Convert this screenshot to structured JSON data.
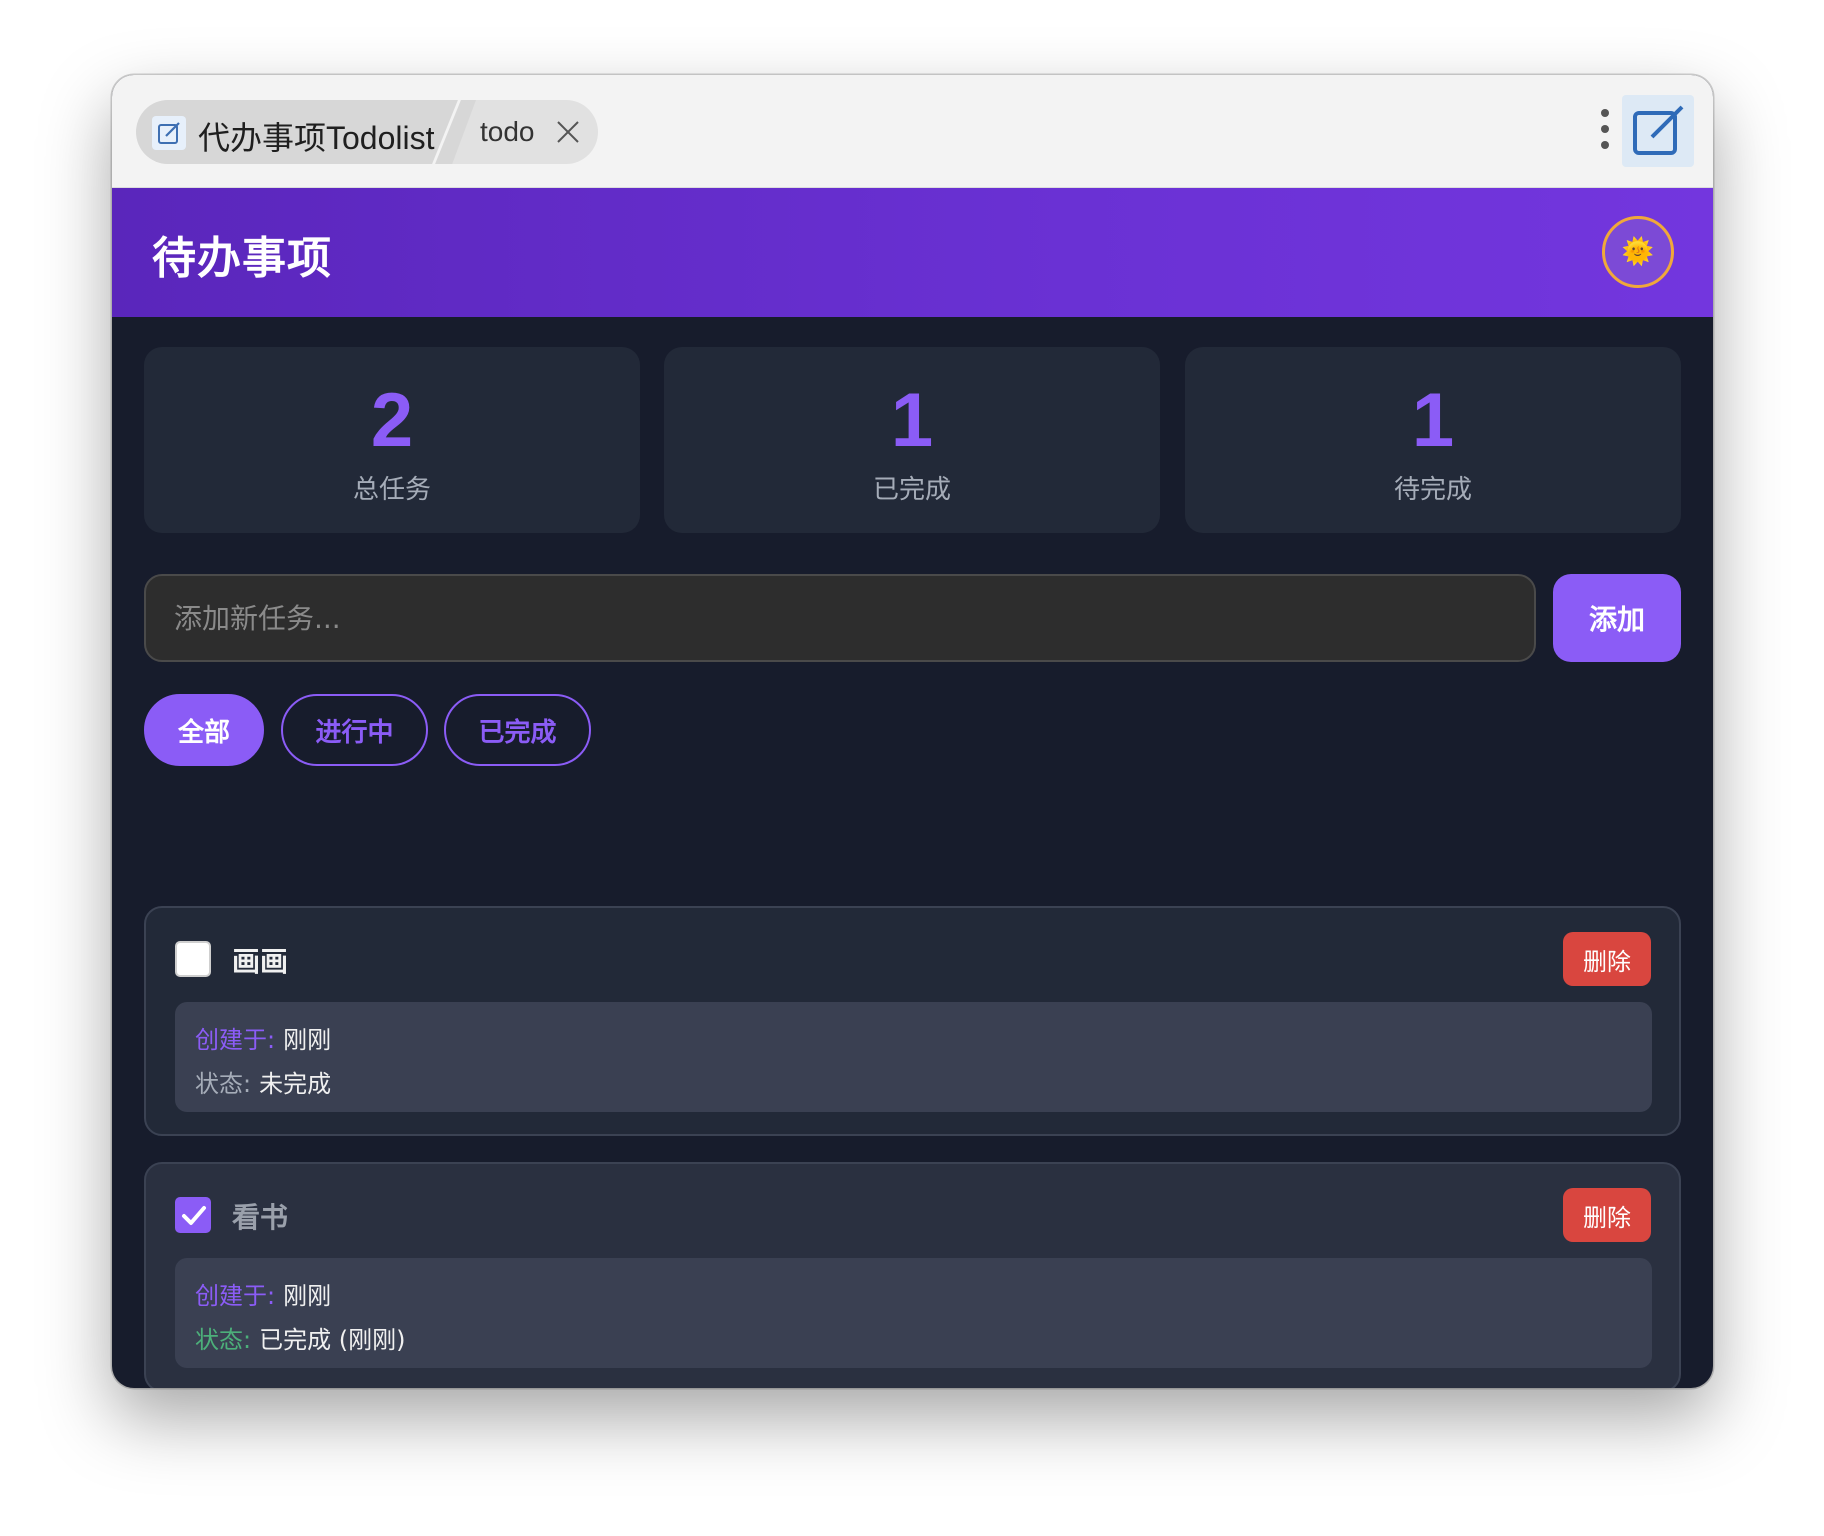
{
  "browser": {
    "tab_title": "代办事项Todolist",
    "tab_subtitle": "todo",
    "tab_icon": "edit-note-icon",
    "menu_icon": "kebab-menu-icon",
    "extension_icon": "edit-note-icon"
  },
  "header": {
    "title": "待办事项",
    "theme_icon": "🌞"
  },
  "stats": [
    {
      "value": "2",
      "label": "总任务"
    },
    {
      "value": "1",
      "label": "已完成"
    },
    {
      "value": "1",
      "label": "待完成"
    }
  ],
  "input": {
    "placeholder": "添加新任务...",
    "value": "",
    "add_label": "添加"
  },
  "filters": [
    {
      "label": "全部",
      "active": true
    },
    {
      "label": "进行中",
      "active": false
    },
    {
      "label": "已完成",
      "active": false
    }
  ],
  "tasks": [
    {
      "title": "画画",
      "checked": false,
      "delete_label": "删除",
      "created_key": "创建于:",
      "created_val": "刚刚",
      "status_key": "状态:",
      "status_val": "未完成"
    },
    {
      "title": "看书",
      "checked": true,
      "delete_label": "删除",
      "created_key": "创建于:",
      "created_val": "刚刚",
      "status_key": "状态:",
      "status_val": "已完成 (刚刚)"
    }
  ],
  "colors": {
    "accent": "#8b5cf6",
    "header_start": "#5a26bb",
    "header_end": "#7336de",
    "danger": "#d9463f",
    "success": "#4caf7a",
    "background": "#171c2c",
    "card": "#222938"
  }
}
